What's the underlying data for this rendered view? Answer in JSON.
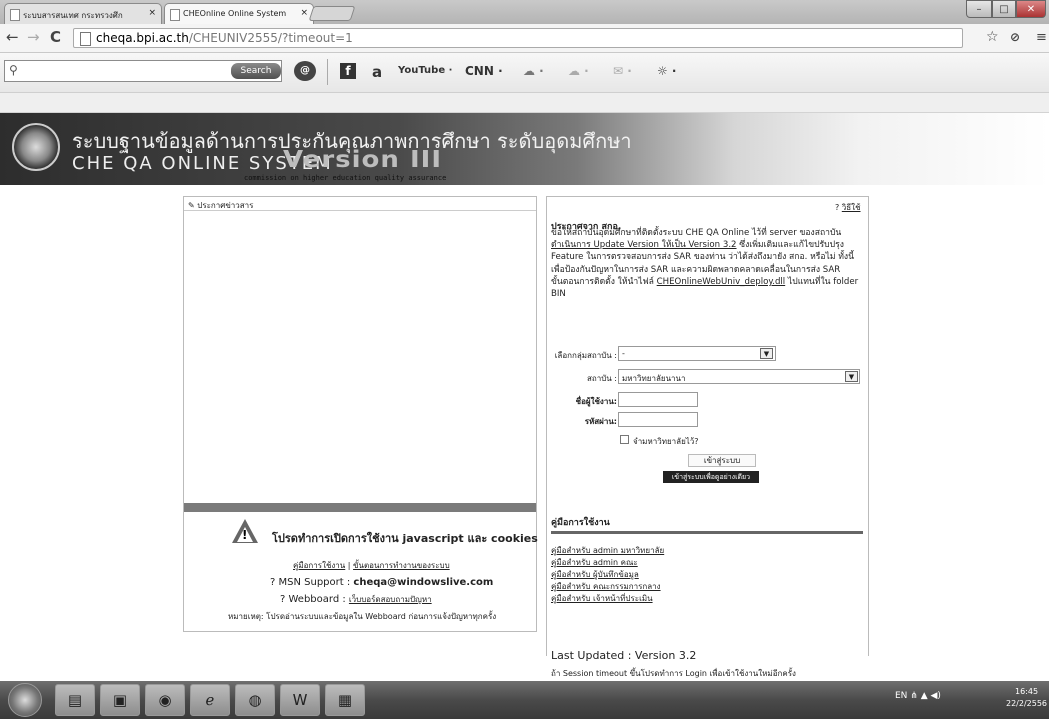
{
  "browser": {
    "tabs": [
      {
        "label": "ระบบสารสนเทศ กระทรวงศึก"
      },
      {
        "label": "CHEOnline Online System"
      }
    ],
    "url_host": "cheqa.bpi.ac.th",
    "url_path": "/CHEUNIV2555/?timeout=1",
    "search_button": "Search",
    "search_value": ""
  },
  "toolbar": {
    "icons": [
      "search-icon",
      "facebook-icon",
      "amazon-icon",
      "youtube-icon",
      "cnn-icon",
      "weather-icon",
      "mail-icon"
    ],
    "youtube": "YouTube",
    "cnn": "CNN",
    "amazon": "a"
  },
  "banner": {
    "thai_title": "ระบบฐานข้อมูลด้านการประกันคุณภาพการศึกษา ระดับอุดมศึกษา",
    "english_title": "CHE QA ONLINE SYSTEM",
    "version": "Version III",
    "commission": "commission on higher education quality assurance"
  },
  "left_panel": {
    "header": "ประกาศข่าวสาร",
    "warning": "โปรดทำการเปิดการใช้งาน javascript และ cookies",
    "link_manual": "คู่มือการใช้งาน",
    "link_steps": "ขั้นตอนการทำงานของระบบ",
    "msn_label": "MSN Support :",
    "msn_email": "cheqa@windowslive.com",
    "webboard_label": "Webboard",
    "webboard_link": "เว็บบอร์ดสอบถามปัญหา",
    "note": "หมายเหตุ: โปรดอ่านระบบและข้อมูลใน Webboard ก่อนการแจ้งปัญหาทุกครั้ง"
  },
  "right_panel": {
    "help": "วิธีใช้",
    "announce_title": "ประกาศจาก สกอ.",
    "announce_1": "ขอให้สถาบันอุดมศึกษาที่ติดตั้งระบบ CHE QA Online ไว้ที่ server ของสถาบัน",
    "announce_link1": "ดำเนินการ Update Version ให้เป็น Version 3.2",
    "announce_2": "ซึ่งเพิ่มเติมและแก้ไขปรับปรุง Feature ในการตรวจสอบการส่ง SAR ของท่าน ว่าได้ส่งถึงมายัง สกอ. หรือไม่ ทั้งนี้เพื่อป้องกันปัญหาในการส่ง SAR และความผิดพลาดคลาดเคลื่อนในการส่ง SAR",
    "announce_3": "ขั้นตอนการติดตั้ง ให้นำไฟล์",
    "announce_link2": "CHEOnlineWebUniv_deploy.dll",
    "announce_4": "ไปแทนที่ใน folder BIN",
    "group_label": "เลือกกลุ่มสถาบัน :",
    "group_value": "-",
    "inst_label": "สถาบัน :",
    "inst_value": "มหาวิทยาลัยนานา",
    "user_label": "ชื่อผู้ใช้งาน:",
    "pass_label": "รหัสผ่าน:",
    "remember": "จำมหาวิทยาลัยไว้?",
    "login_btn": "เข้าสู่ระบบ",
    "guest_btn": "เข้าสู่ระบบเพื่อดูอย่างเดียว",
    "manual_title": "คู่มือการใช้งาน",
    "manuals": [
      "คู่มือสำหรับ admin มหาวิทยาลัย",
      "คู่มือสำหรับ admin คณะ",
      "คู่มือสำหรับ ผู้บันทึกข้อมูล",
      "คู่มือสำหรับ คณะกรรมการกลาง",
      "คู่มือสำหรับ เจ้าหน้าที่ประเมิน"
    ],
    "last_updated_label": "Last Updated : Version",
    "last_updated_value": "3.2",
    "session_note": "ถ้า Session timeout ขึ้นโปรดทำการ Login เพื่อเข้าใช้งานใหม่อีกครั้ง"
  },
  "taskbar": {
    "lang": "EN",
    "time": "16:45",
    "date": "22/2/2556"
  }
}
